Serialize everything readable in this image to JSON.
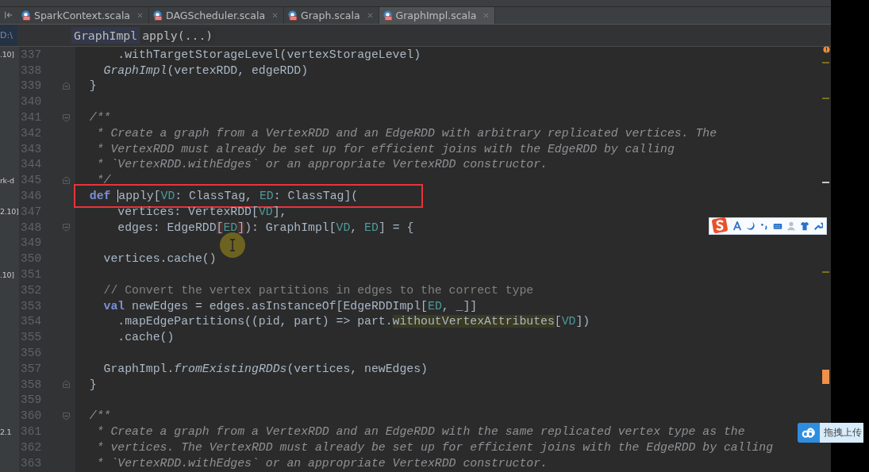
{
  "tabs": [
    {
      "label": "SparkContext.scala",
      "selected": false
    },
    {
      "label": "DAGScheduler.scala",
      "selected": false
    },
    {
      "label": "Graph.scala",
      "selected": false
    },
    {
      "label": "GraphImpl.scala",
      "selected": true
    }
  ],
  "breadcrumb": {
    "side_label": "D:\\",
    "items": [
      {
        "label": "GraphImpl",
        "selected": true
      },
      {
        "label": "apply(...)",
        "selected": false
      }
    ]
  },
  "lines": [
    {
      "number": "337",
      "side_label": ".10]",
      "segments": [
        {
          "kind": "plain",
          "text": "      .withTargetStorageLevel(vertexStorageLevel)"
        }
      ]
    },
    {
      "number": "338",
      "segments": [
        {
          "kind": "italic",
          "text": "    GraphImpl"
        },
        {
          "kind": "plain",
          "text": "(vertexRDD, edgeRDD)"
        }
      ]
    },
    {
      "number": "339",
      "fold_end": true,
      "segments": [
        {
          "kind": "plain",
          "text": "  }"
        }
      ]
    },
    {
      "number": "340"
    },
    {
      "number": "341",
      "fold_start": true,
      "segments": [
        {
          "kind": "doc",
          "text": "  /**"
        }
      ]
    },
    {
      "number": "342",
      "segments": [
        {
          "kind": "doc",
          "text": "   * Create a graph from a VertexRDD and an EdgeRDD with arbitrary replicated vertices. The"
        }
      ]
    },
    {
      "number": "343",
      "segments": [
        {
          "kind": "doc",
          "text": "   * VertexRDD must already be set up for efficient joins with the EdgeRDD by calling"
        }
      ]
    },
    {
      "number": "344",
      "segments": [
        {
          "kind": "doc",
          "text": "   * `VertexRDD.withEdges` or an appropriate VertexRDD constructor."
        }
      ]
    },
    {
      "number": "345",
      "side_label": "rk-d",
      "fold_end": true,
      "segments": [
        {
          "kind": "doc",
          "text": "   */"
        }
      ]
    },
    {
      "number": "346",
      "boxed": true,
      "segments": [
        {
          "kind": "keyword",
          "text": "  def "
        },
        {
          "kind": "plain",
          "caret": true,
          "text": "apply["
        },
        {
          "kind": "type-param",
          "text": "VD"
        },
        {
          "kind": "plain",
          "text": ": ClassTag, "
        },
        {
          "kind": "type-param",
          "text": "ED"
        },
        {
          "kind": "plain",
          "text": ": ClassTag]("
        }
      ]
    },
    {
      "number": "347",
      "side_label": "2.10]",
      "segments": [
        {
          "kind": "plain",
          "text": "      vertices: VertexRDD["
        },
        {
          "kind": "type-param",
          "text": "VD"
        },
        {
          "kind": "plain",
          "text": "],"
        }
      ]
    },
    {
      "number": "348",
      "fold_start": true,
      "segments": [
        {
          "kind": "plain",
          "text": "      edges: EdgeRDD"
        },
        {
          "kind": "matched",
          "text": "["
        },
        {
          "kind": "type-param",
          "text": "ED"
        },
        {
          "kind": "matched",
          "text": "]"
        },
        {
          "kind": "plain",
          "text": "): GraphImpl["
        },
        {
          "kind": "type-param",
          "text": "VD"
        },
        {
          "kind": "plain",
          "text": ", "
        },
        {
          "kind": "type-param",
          "text": "ED"
        },
        {
          "kind": "plain",
          "text": "] = {"
        }
      ]
    },
    {
      "number": "349"
    },
    {
      "number": "350",
      "segments": [
        {
          "kind": "plain",
          "text": "    vertices.cache()"
        }
      ]
    },
    {
      "number": "351",
      "side_label": ".10]"
    },
    {
      "number": "352",
      "segments": [
        {
          "kind": "comment",
          "text": "    // Convert the vertex partitions in edges to the correct type"
        }
      ]
    },
    {
      "number": "353",
      "segments": [
        {
          "kind": "keyword",
          "text": "    val"
        },
        {
          "kind": "plain",
          "text": " newEdges = edges.asInstanceOf[EdgeRDDImpl["
        },
        {
          "kind": "type-param",
          "text": "ED"
        },
        {
          "kind": "plain",
          "text": ", _]]"
        }
      ]
    },
    {
      "number": "354",
      "segments": [
        {
          "kind": "plain",
          "text": "      .mapEdgePartitions((pid, part) => part."
        },
        {
          "kind": "implicit",
          "text": "withoutVertexAttributes"
        },
        {
          "kind": "plain",
          "text": "["
        },
        {
          "kind": "type-param",
          "text": "VD"
        },
        {
          "kind": "plain",
          "text": "])"
        }
      ]
    },
    {
      "number": "355",
      "segments": [
        {
          "kind": "plain",
          "text": "      .cache()"
        }
      ]
    },
    {
      "number": "356"
    },
    {
      "number": "357",
      "segments": [
        {
          "kind": "plain",
          "text": "    GraphImpl."
        },
        {
          "kind": "italic",
          "text": "fromExistingRDDs"
        },
        {
          "kind": "plain",
          "text": "(vertices, newEdges)"
        }
      ]
    },
    {
      "number": "358",
      "fold_end": true,
      "segments": [
        {
          "kind": "plain",
          "text": "  }"
        }
      ]
    },
    {
      "number": "359"
    },
    {
      "number": "360",
      "fold_start": true,
      "segments": [
        {
          "kind": "doc",
          "text": "  /**"
        }
      ]
    },
    {
      "number": "361",
      "side_label": "2.1",
      "segments": [
        {
          "kind": "doc",
          "text": "   * Create a graph from a VertexRDD and an EdgeRDD with the same replicated vertex type as the"
        }
      ]
    },
    {
      "number": "362",
      "segments": [
        {
          "kind": "doc",
          "text": "   * vertices. The VertexRDD must already be set up for efficient joins with the EdgeRDD by calling"
        }
      ]
    },
    {
      "number": "363",
      "segments": [
        {
          "kind": "doc",
          "text": "   * `VertexRDD.withEdges` or an appropriate VertexRDD constructor."
        }
      ]
    }
  ],
  "upload_widget": {
    "label": "拖拽上传"
  }
}
